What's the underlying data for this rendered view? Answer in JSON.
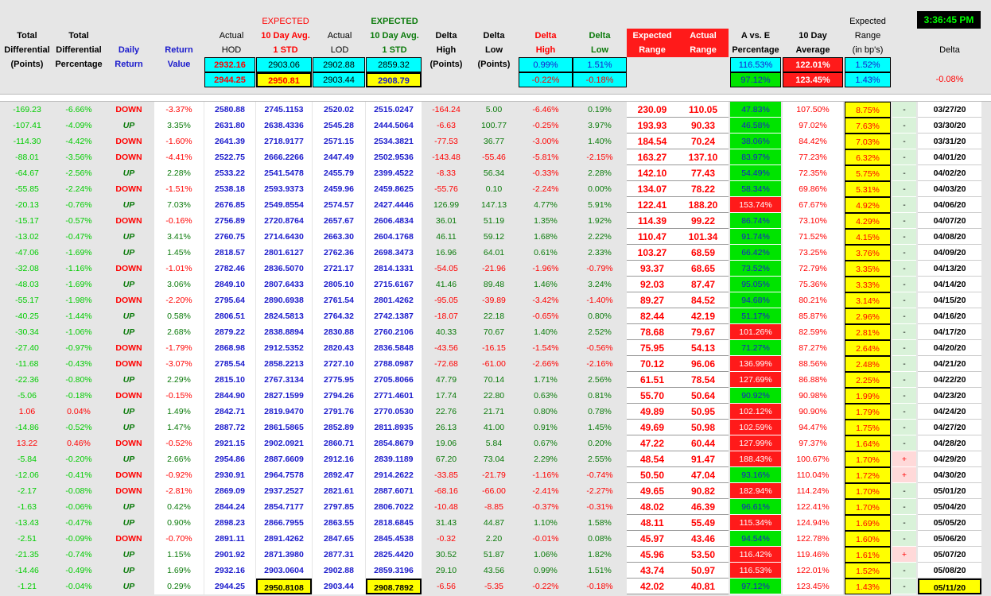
{
  "clock": "3:36:45 PM",
  "colors": {
    "green": "#00cc00",
    "red": "#ff0000",
    "blue": "#1a1acc",
    "darkgreen": "#0a7a0a",
    "yellow": "#ffff00",
    "cyan": "#00ffff",
    "bggreen": "#00e400",
    "bgred": "#ff1a1a",
    "palegreen": "#d9f2d9",
    "palepink": "#ffd9d9"
  },
  "headers": {
    "total_diff_points": "Total\nDifferential\n(Points)",
    "total_diff_pct": "Total\nDifferential\nPercentage",
    "daily_return": "Daily\nReturn",
    "return_value": "Return\nValue",
    "actual_hod": "Actual\nHOD",
    "expected_hod_top": "EXPECTED",
    "expected_hod": "10 Day Avg.\n1 STD",
    "actual_lod": "Actual\nLOD",
    "expected_lod_top": "EXPECTED",
    "expected_lod": "10 Day Avg.\n1 STD",
    "delta_high_pts": "Delta\nHigh\n(Points)",
    "delta_low_pts": "Delta\nLow\n(Points)",
    "delta_high": "Delta\nHigh",
    "delta_low": "Delta\nLow",
    "expected_range": "Expected\nRange",
    "actual_range": "Actual\nRange",
    "a_vs_e": "A vs. E\nPercentage",
    "ten_day_avg": "10 Day\nAverage",
    "expected_range_bps": "Expected\nRange\n(in bp's)",
    "delta": "Delta"
  },
  "summary": {
    "row1": {
      "hod": "2932.16",
      "exp_hod": "2903.06",
      "lod": "2902.88",
      "exp_lod": "2859.32",
      "delta_high": "0.99%",
      "delta_low": "1.51%",
      "ave": "116.53%",
      "ten_day": "122.01%",
      "bps": "1.52%"
    },
    "row2": {
      "hod": "2944.25",
      "exp_hod": "2950.81",
      "lod": "2903.44",
      "exp_lod": "2908.79",
      "delta_high": "-0.22%",
      "delta_low": "-0.18%",
      "ave": "97.12%",
      "ten_day": "123.45%",
      "bps": "1.43%",
      "delta": "-0.08%"
    }
  },
  "rows": [
    [
      "-169.23",
      "-6.66%",
      "DOWN",
      "-3.37%",
      "2580.88",
      "2745.1153",
      "2520.02",
      "2515.0247",
      "-164.24",
      "5.00",
      "-6.46%",
      "0.19%",
      "230.09",
      "110.05",
      "47.83%",
      "107.50%",
      "8.75%",
      "-",
      "03/27/20"
    ],
    [
      "-107.41",
      "-4.09%",
      "UP",
      "3.35%",
      "2631.80",
      "2638.4336",
      "2545.28",
      "2444.5064",
      "-6.63",
      "100.77",
      "-0.25%",
      "3.97%",
      "193.93",
      "90.33",
      "46.58%",
      "97.02%",
      "7.63%",
      "-",
      "03/30/20"
    ],
    [
      "-114.30",
      "-4.42%",
      "DOWN",
      "-1.60%",
      "2641.39",
      "2718.9177",
      "2571.15",
      "2534.3821",
      "-77.53",
      "36.77",
      "-3.00%",
      "1.40%",
      "184.54",
      "70.24",
      "38.06%",
      "84.42%",
      "7.03%",
      "-",
      "03/31/20"
    ],
    [
      "-88.01",
      "-3.56%",
      "DOWN",
      "-4.41%",
      "2522.75",
      "2666.2266",
      "2447.49",
      "2502.9536",
      "-143.48",
      "-55.46",
      "-5.81%",
      "-2.15%",
      "163.27",
      "137.10",
      "83.97%",
      "77.23%",
      "6.32%",
      "-",
      "04/01/20"
    ],
    [
      "-64.67",
      "-2.56%",
      "UP",
      "2.28%",
      "2533.22",
      "2541.5478",
      "2455.79",
      "2399.4522",
      "-8.33",
      "56.34",
      "-0.33%",
      "2.28%",
      "142.10",
      "77.43",
      "54.49%",
      "72.35%",
      "5.75%",
      "-",
      "04/02/20"
    ],
    [
      "-55.85",
      "-2.24%",
      "DOWN",
      "-1.51%",
      "2538.18",
      "2593.9373",
      "2459.96",
      "2459.8625",
      "-55.76",
      "0.10",
      "-2.24%",
      "0.00%",
      "134.07",
      "78.22",
      "58.34%",
      "69.86%",
      "5.31%",
      "-",
      "04/03/20"
    ],
    [
      "-20.13",
      "-0.76%",
      "UP",
      "7.03%",
      "2676.85",
      "2549.8554",
      "2574.57",
      "2427.4446",
      "126.99",
      "147.13",
      "4.77%",
      "5.91%",
      "122.41",
      "188.20",
      "153.74%",
      "67.67%",
      "4.92%",
      "-",
      "04/06/20"
    ],
    [
      "-15.17",
      "-0.57%",
      "DOWN",
      "-0.16%",
      "2756.89",
      "2720.8764",
      "2657.67",
      "2606.4834",
      "36.01",
      "51.19",
      "1.35%",
      "1.92%",
      "114.39",
      "99.22",
      "86.74%",
      "73.10%",
      "4.29%",
      "-",
      "04/07/20"
    ],
    [
      "-13.02",
      "-0.47%",
      "UP",
      "3.41%",
      "2760.75",
      "2714.6430",
      "2663.30",
      "2604.1768",
      "46.11",
      "59.12",
      "1.68%",
      "2.22%",
      "110.47",
      "101.34",
      "91.74%",
      "71.52%",
      "4.15%",
      "-",
      "04/08/20"
    ],
    [
      "-47.06",
      "-1.69%",
      "UP",
      "1.45%",
      "2818.57",
      "2801.6127",
      "2762.36",
      "2698.3473",
      "16.96",
      "64.01",
      "0.61%",
      "2.33%",
      "103.27",
      "68.59",
      "66.42%",
      "73.25%",
      "3.76%",
      "-",
      "04/09/20"
    ],
    [
      "-32.08",
      "-1.16%",
      "DOWN",
      "-1.01%",
      "2782.46",
      "2836.5070",
      "2721.17",
      "2814.1331",
      "-54.05",
      "-21.96",
      "-1.96%",
      "-0.79%",
      "93.37",
      "68.65",
      "73.52%",
      "72.79%",
      "3.35%",
      "-",
      "04/13/20"
    ],
    [
      "-48.03",
      "-1.69%",
      "UP",
      "3.06%",
      "2849.10",
      "2807.6433",
      "2805.10",
      "2715.6167",
      "41.46",
      "89.48",
      "1.46%",
      "3.24%",
      "92.03",
      "87.47",
      "95.05%",
      "75.36%",
      "3.33%",
      "-",
      "04/14/20"
    ],
    [
      "-55.17",
      "-1.98%",
      "DOWN",
      "-2.20%",
      "2795.64",
      "2890.6938",
      "2761.54",
      "2801.4262",
      "-95.05",
      "-39.89",
      "-3.42%",
      "-1.40%",
      "89.27",
      "84.52",
      "94.68%",
      "80.21%",
      "3.14%",
      "-",
      "04/15/20"
    ],
    [
      "-40.25",
      "-1.44%",
      "UP",
      "0.58%",
      "2806.51",
      "2824.5813",
      "2764.32",
      "2742.1387",
      "-18.07",
      "22.18",
      "-0.65%",
      "0.80%",
      "82.44",
      "42.19",
      "51.17%",
      "85.87%",
      "2.96%",
      "-",
      "04/16/20"
    ],
    [
      "-30.34",
      "-1.06%",
      "UP",
      "2.68%",
      "2879.22",
      "2838.8894",
      "2830.88",
      "2760.2106",
      "40.33",
      "70.67",
      "1.40%",
      "2.52%",
      "78.68",
      "79.67",
      "101.26%",
      "82.59%",
      "2.81%",
      "-",
      "04/17/20"
    ],
    [
      "-27.40",
      "-0.97%",
      "DOWN",
      "-1.79%",
      "2868.98",
      "2912.5352",
      "2820.43",
      "2836.5848",
      "-43.56",
      "-16.15",
      "-1.54%",
      "-0.56%",
      "75.95",
      "54.13",
      "71.27%",
      "87.27%",
      "2.64%",
      "-",
      "04/20/20"
    ],
    [
      "-11.68",
      "-0.43%",
      "DOWN",
      "-3.07%",
      "2785.54",
      "2858.2213",
      "2727.10",
      "2788.0987",
      "-72.68",
      "-61.00",
      "-2.66%",
      "-2.16%",
      "70.12",
      "96.06",
      "136.99%",
      "88.56%",
      "2.48%",
      "-",
      "04/21/20"
    ],
    [
      "-22.36",
      "-0.80%",
      "UP",
      "2.29%",
      "2815.10",
      "2767.3134",
      "2775.95",
      "2705.8066",
      "47.79",
      "70.14",
      "1.71%",
      "2.56%",
      "61.51",
      "78.54",
      "127.69%",
      "86.88%",
      "2.25%",
      "-",
      "04/22/20"
    ],
    [
      "-5.06",
      "-0.18%",
      "DOWN",
      "-0.15%",
      "2844.90",
      "2827.1599",
      "2794.26",
      "2771.4601",
      "17.74",
      "22.80",
      "0.63%",
      "0.81%",
      "55.70",
      "50.64",
      "90.92%",
      "90.98%",
      "1.99%",
      "-",
      "04/23/20"
    ],
    [
      "1.06",
      "0.04%",
      "UP",
      "1.49%",
      "2842.71",
      "2819.9470",
      "2791.76",
      "2770.0530",
      "22.76",
      "21.71",
      "0.80%",
      "0.78%",
      "49.89",
      "50.95",
      "102.12%",
      "90.90%",
      "1.79%",
      "-",
      "04/24/20"
    ],
    [
      "-14.86",
      "-0.52%",
      "UP",
      "1.47%",
      "2887.72",
      "2861.5865",
      "2852.89",
      "2811.8935",
      "26.13",
      "41.00",
      "0.91%",
      "1.45%",
      "49.69",
      "50.98",
      "102.59%",
      "94.47%",
      "1.75%",
      "-",
      "04/27/20"
    ],
    [
      "13.22",
      "0.46%",
      "DOWN",
      "-0.52%",
      "2921.15",
      "2902.0921",
      "2860.71",
      "2854.8679",
      "19.06",
      "5.84",
      "0.67%",
      "0.20%",
      "47.22",
      "60.44",
      "127.99%",
      "97.37%",
      "1.64%",
      "-",
      "04/28/20"
    ],
    [
      "-5.84",
      "-0.20%",
      "UP",
      "2.66%",
      "2954.86",
      "2887.6609",
      "2912.16",
      "2839.1189",
      "67.20",
      "73.04",
      "2.29%",
      "2.55%",
      "48.54",
      "91.47",
      "188.43%",
      "100.67%",
      "1.70%",
      "+",
      "04/29/20"
    ],
    [
      "-12.06",
      "-0.41%",
      "DOWN",
      "-0.92%",
      "2930.91",
      "2964.7578",
      "2892.47",
      "2914.2622",
      "-33.85",
      "-21.79",
      "-1.16%",
      "-0.74%",
      "50.50",
      "47.04",
      "93.16%",
      "110.04%",
      "1.72%",
      "+",
      "04/30/20"
    ],
    [
      "-2.17",
      "-0.08%",
      "DOWN",
      "-2.81%",
      "2869.09",
      "2937.2527",
      "2821.61",
      "2887.6071",
      "-68.16",
      "-66.00",
      "-2.41%",
      "-2.27%",
      "49.65",
      "90.82",
      "182.94%",
      "114.24%",
      "1.70%",
      "-",
      "05/01/20"
    ],
    [
      "-1.63",
      "-0.06%",
      "UP",
      "0.42%",
      "2844.24",
      "2854.7177",
      "2797.85",
      "2806.7022",
      "-10.48",
      "-8.85",
      "-0.37%",
      "-0.31%",
      "48.02",
      "46.39",
      "96.61%",
      "122.41%",
      "1.70%",
      "-",
      "05/04/20"
    ],
    [
      "-13.43",
      "-0.47%",
      "UP",
      "0.90%",
      "2898.23",
      "2866.7955",
      "2863.55",
      "2818.6845",
      "31.43",
      "44.87",
      "1.10%",
      "1.58%",
      "48.11",
      "55.49",
      "115.34%",
      "124.94%",
      "1.69%",
      "-",
      "05/05/20"
    ],
    [
      "-2.51",
      "-0.09%",
      "DOWN",
      "-0.70%",
      "2891.11",
      "2891.4262",
      "2847.65",
      "2845.4538",
      "-0.32",
      "2.20",
      "-0.01%",
      "0.08%",
      "45.97",
      "43.46",
      "94.54%",
      "122.78%",
      "1.60%",
      "-",
      "05/06/20"
    ],
    [
      "-21.35",
      "-0.74%",
      "UP",
      "1.15%",
      "2901.92",
      "2871.3980",
      "2877.31",
      "2825.4420",
      "30.52",
      "51.87",
      "1.06%",
      "1.82%",
      "45.96",
      "53.50",
      "116.42%",
      "119.46%",
      "1.61%",
      "+",
      "05/07/20"
    ],
    [
      "-14.46",
      "-0.49%",
      "UP",
      "1.69%",
      "2932.16",
      "2903.0604",
      "2902.88",
      "2859.3196",
      "29.10",
      "43.56",
      "0.99%",
      "1.51%",
      "43.74",
      "50.97",
      "116.53%",
      "122.01%",
      "1.52%",
      "-",
      "05/08/20"
    ],
    [
      "-1.21",
      "-0.04%",
      "UP",
      "0.29%",
      "2944.25",
      "2950.8108",
      "2903.44",
      "2908.7892",
      "-6.56",
      "-5.35",
      "-0.22%",
      "-0.18%",
      "42.02",
      "40.81",
      "97.12%",
      "123.45%",
      "1.43%",
      "-",
      "05/11/20"
    ]
  ]
}
